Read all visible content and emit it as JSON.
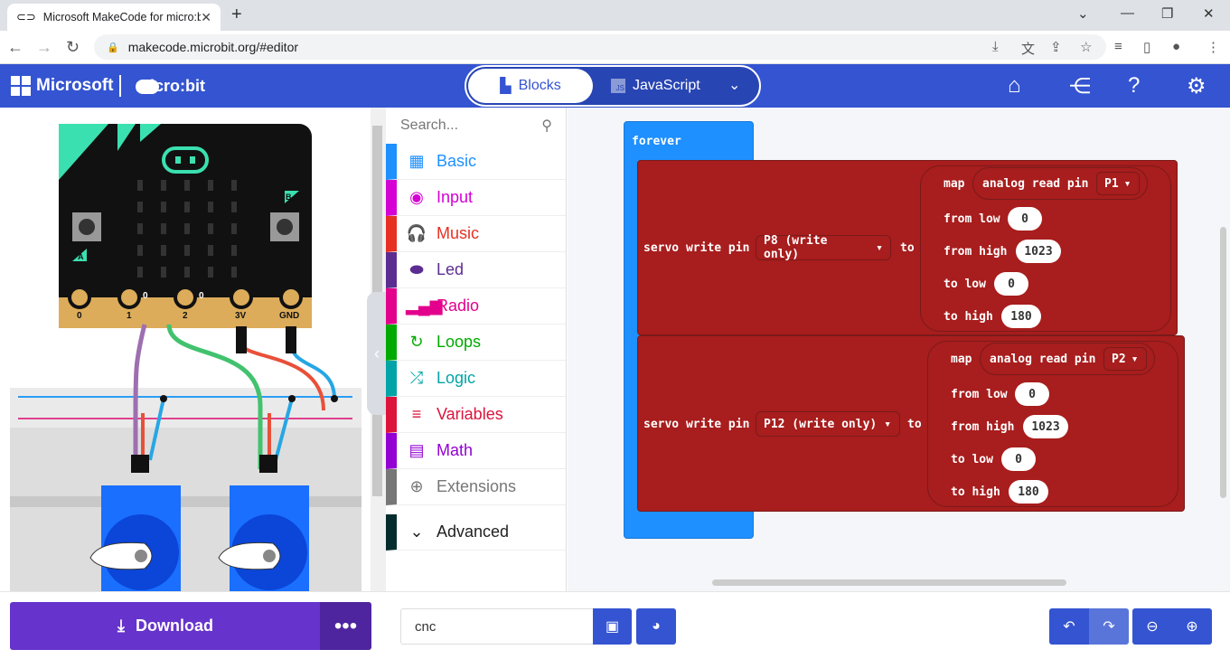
{
  "browser": {
    "tab_title": "Microsoft MakeCode for micro:bi",
    "url": "makecode.microbit.org/#editor"
  },
  "header": {
    "microsoft": "Microsoft",
    "microbit": "micro:bit",
    "blocks_label": "Blocks",
    "js_label": "JavaScript"
  },
  "toolbox": {
    "search_placeholder": "Search...",
    "categories": [
      {
        "label": "Basic",
        "color": "#1e90ff"
      },
      {
        "label": "Input",
        "color": "#d400d4"
      },
      {
        "label": "Music",
        "color": "#e63022"
      },
      {
        "label": "Led",
        "color": "#5c2d91"
      },
      {
        "label": "Radio",
        "color": "#e3008c"
      },
      {
        "label": "Loops",
        "color": "#00aa00"
      },
      {
        "label": "Logic",
        "color": "#00a4a6"
      },
      {
        "label": "Variables",
        "color": "#dc143c"
      },
      {
        "label": "Math",
        "color": "#9400d3"
      },
      {
        "label": "Extensions",
        "color": "#777777"
      },
      {
        "label": "Advanced",
        "color": "#042c2c"
      }
    ]
  },
  "simulator": {
    "pin_labels": [
      "0",
      "1",
      "2",
      "3V",
      "GND"
    ],
    "button_a": "A",
    "button_b": "B",
    "pin_small_1": "0",
    "pin_small_2": "0"
  },
  "workspace": {
    "forever": "forever",
    "block1": {
      "servo_text": "servo write pin",
      "pin": "P8 (write only)",
      "to": "to",
      "map": "map",
      "analog": "analog read pin",
      "analog_pin": "P1",
      "from_low_label": "from low",
      "from_low": "0",
      "from_high_label": "from high",
      "from_high": "1023",
      "to_low_label": "to low",
      "to_low": "0",
      "to_high_label": "to high",
      "to_high": "180"
    },
    "block2": {
      "servo_text": "servo write pin",
      "pin": "P12 (write only)",
      "to": "to",
      "map": "map",
      "analog": "analog read pin",
      "analog_pin": "P2",
      "from_low_label": "from low",
      "from_low": "0",
      "from_high_label": "from high",
      "from_high": "1023",
      "to_low_label": "to low",
      "to_low": "0",
      "to_high_label": "to high",
      "to_high": "180"
    }
  },
  "bottom": {
    "download": "Download",
    "project_name": "cnc"
  },
  "colors": {
    "header": "#3454d1",
    "block_red": "#a81d1d",
    "forever_blue": "#1e90ff",
    "download": "#6633cc"
  }
}
